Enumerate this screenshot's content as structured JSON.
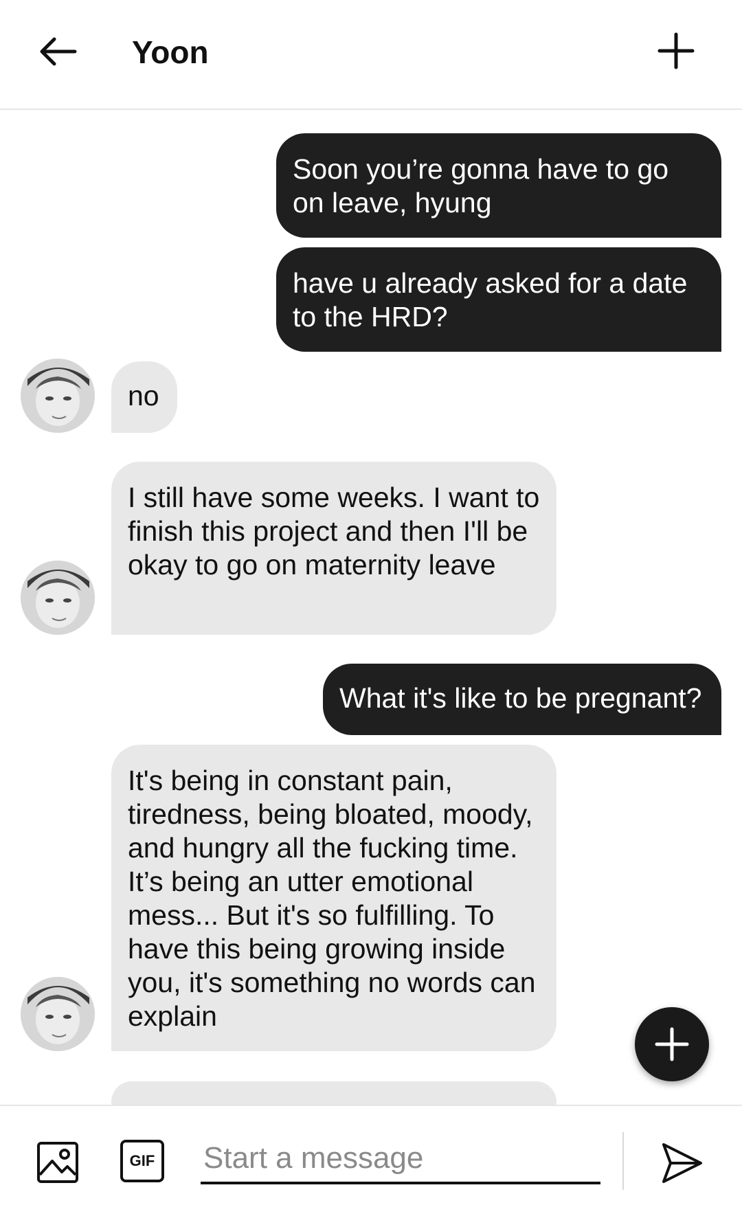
{
  "header": {
    "title": "Yoon",
    "back_icon": "arrow-left-icon",
    "add_icon": "plus-icon"
  },
  "messages": [
    {
      "from": "me",
      "text": "Soon you’re gonna have to go on leave, hyung"
    },
    {
      "from": "me",
      "text": "have u already asked for a date to the HRD?"
    },
    {
      "from": "them",
      "text": "no"
    },
    {
      "from": "them",
      "text": "I still have some weeks. I want to finish this project and then I'll be okay to go on maternity leave"
    },
    {
      "from": "me",
      "text": "What it's like to be pregnant?"
    },
    {
      "from": "them",
      "text": "It's being in constant pain, tiredness, being bloated, moody, and hungry all the fucking time. It’s being an utter emotional mess... But it's so fulfilling. To have this being growing inside you, it's something no words can explain"
    }
  ],
  "composer": {
    "placeholder": "Start a message",
    "value": "",
    "gif_label": "GIF"
  },
  "colors": {
    "outgoing_bubble": "#1f1f1f",
    "incoming_bubble": "#e8e8e8",
    "accent": "#1a1a1a"
  }
}
